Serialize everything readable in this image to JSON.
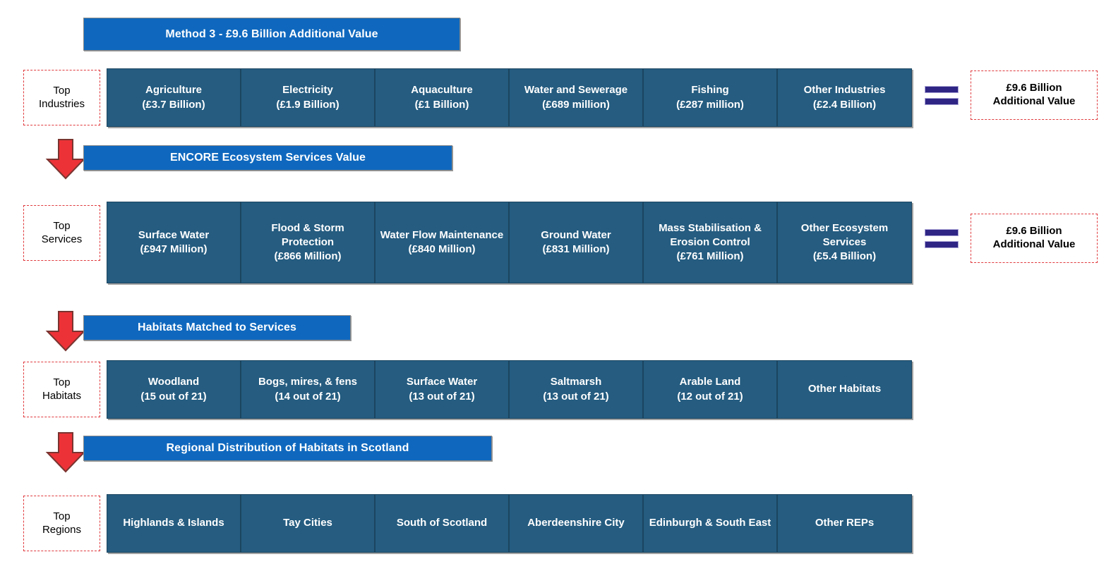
{
  "colors": {
    "banner_blue": "#0F68BE",
    "cell_blue": "#255C80",
    "arrow_red": "#ED3237",
    "dash_red": "#E03A3E",
    "equals_purple": "#2E2585",
    "text_white": "#FFFFFF",
    "text_black": "#000000"
  },
  "banners": [
    {
      "id": "method-3",
      "label": "Method 3 - £9.6 Billion Additional Value"
    },
    {
      "id": "encore",
      "label": "ENCORE Ecosystem Services Value"
    },
    {
      "id": "habitats-matched",
      "label": "Habitats Matched to Services"
    },
    {
      "id": "regional-distribution",
      "label": "Regional Distribution of Habitats in Scotland"
    }
  ],
  "rows": [
    {
      "id": "industries",
      "row_label": {
        "line1": "Top",
        "line2": "Industries"
      },
      "cells": [
        {
          "name": "Agriculture",
          "value": "(£3.7 Billion)"
        },
        {
          "name": "Electricity",
          "value": "(£1.9 Billion)"
        },
        {
          "name": "Aquaculture",
          "value": "(£1 Billion)"
        },
        {
          "name": "Water and Sewerage",
          "value": "(£689 million)"
        },
        {
          "name": "Fishing",
          "value": "(£287 million)"
        },
        {
          "name": "Other Industries",
          "value": "(£2.4 Billion)"
        }
      ],
      "result": {
        "line1": "£9.6 Billion",
        "line2": "Additional Value"
      }
    },
    {
      "id": "services",
      "row_label": {
        "line1": "Top",
        "line2": "Services"
      },
      "cells": [
        {
          "name": "Surface Water",
          "value": "(£947 Million)"
        },
        {
          "name": "Flood & Storm Protection",
          "value": "(£866 Million)"
        },
        {
          "name": "Water Flow Maintenance",
          "value": "(£840 Million)"
        },
        {
          "name": "Ground Water",
          "value": "(£831 Million)"
        },
        {
          "name": "Mass Stabilisation & Erosion Control",
          "value": "(£761 Million)"
        },
        {
          "name": "Other Ecosystem Services",
          "value": "(£5.4 Billion)"
        }
      ],
      "result": {
        "line1": "£9.6 Billion",
        "line2": "Additional Value"
      }
    },
    {
      "id": "habitats",
      "row_label": {
        "line1": "Top",
        "line2": "Habitats"
      },
      "cells": [
        {
          "name": "Woodland",
          "value": "(15 out of 21)"
        },
        {
          "name": "Bogs, mires, & fens",
          "value": "(14 out of 21)"
        },
        {
          "name": "Surface Water",
          "value": "(13 out of 21)"
        },
        {
          "name": "Saltmarsh",
          "value": "(13 out of 21)"
        },
        {
          "name": "Arable Land",
          "value": "(12 out of 21)"
        },
        {
          "name": "Other Habitats",
          "value": ""
        }
      ],
      "result": null
    },
    {
      "id": "regions",
      "row_label": {
        "line1": "Top",
        "line2": "Regions"
      },
      "cells": [
        {
          "name": "Highlands & Islands",
          "value": ""
        },
        {
          "name": "Tay Cities",
          "value": ""
        },
        {
          "name": "South of Scotland",
          "value": ""
        },
        {
          "name": "Aberdeenshire City",
          "value": ""
        },
        {
          "name": "Edinburgh & South East",
          "value": ""
        },
        {
          "name": "Other REPs",
          "value": ""
        }
      ],
      "result": null
    }
  ],
  "icons": {
    "arrow": "down-arrow-icon",
    "equals": "equals-icon"
  }
}
